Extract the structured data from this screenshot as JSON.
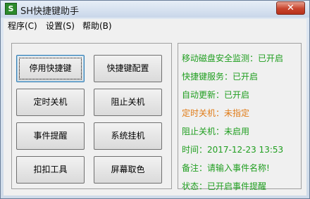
{
  "window": {
    "title": "SH快捷键助手",
    "icon_letter": "S",
    "close_glyph": "✕"
  },
  "menu": [
    {
      "label": "程序(C)"
    },
    {
      "label": "设置(S)"
    },
    {
      "label": "帮助(B)"
    }
  ],
  "buttons": [
    {
      "label": "停用快捷键"
    },
    {
      "label": "快捷键配置"
    },
    {
      "label": "定时关机"
    },
    {
      "label": "阻止关机"
    },
    {
      "label": "事件提醒"
    },
    {
      "label": "系统挂机"
    },
    {
      "label": "扣扣工具"
    },
    {
      "label": "屏幕取色"
    }
  ],
  "status": [
    {
      "text": "移动磁盘安全监测：已开启",
      "color": "#1f9e1f"
    },
    {
      "text": "快捷键服务：已开启",
      "color": "#1f9e1f"
    },
    {
      "text": "自动更新：已开启",
      "color": "#1f9e1f"
    },
    {
      "text": "定时关机：未指定",
      "color": "#e07b17"
    },
    {
      "text": "阻止关机：未启用",
      "color": "#1f9e1f"
    },
    {
      "text": "时间：2017-12-23 13:53",
      "color": "#1f9e1f"
    },
    {
      "text": "备注：请输入事件名称!",
      "color": "#1f9e1f"
    },
    {
      "text": "状态：已开启事件提醒",
      "color": "#1f9e1f"
    }
  ]
}
